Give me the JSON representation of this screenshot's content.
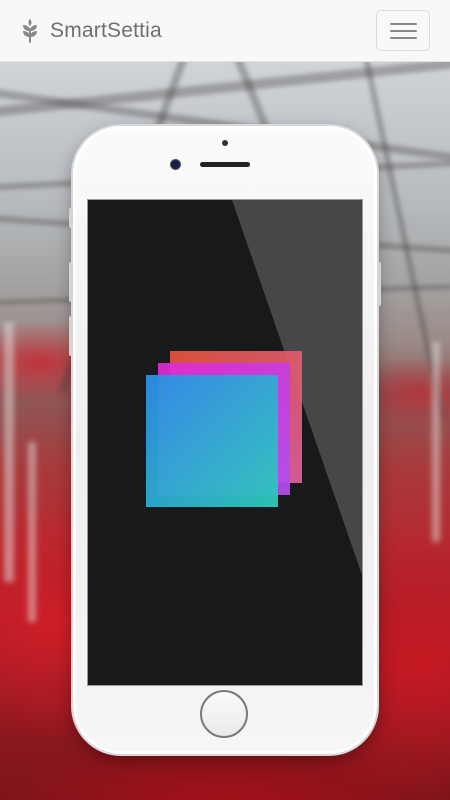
{
  "navbar": {
    "brand": "SmartSettia",
    "brand_icon": "leaf-sprout-icon",
    "menu_icon": "hamburger-menu-icon"
  },
  "hero": {
    "background": "greenhouse-photo",
    "device": "smartphone-mockup",
    "screen_logo": "layered-squares-logo"
  },
  "colors": {
    "navbar_bg": "#f8f8f8",
    "brand_text": "#6f6f6f",
    "screen_bg": "#17191b",
    "logo_back": "#e0486e",
    "logo_middle": "#d83bf0",
    "logo_front_start": "#2d8de8",
    "logo_front_end": "#2ec9ba"
  }
}
